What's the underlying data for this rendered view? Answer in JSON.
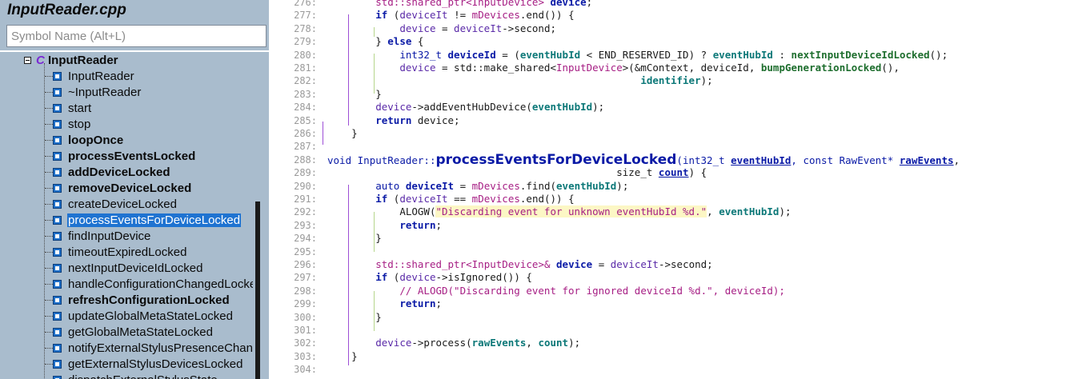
{
  "panel": {
    "title": "InputReader.cpp",
    "search_placeholder": "Symbol Name (Alt+L)",
    "root": {
      "icon": "class-icon",
      "glyph": "C",
      "label": "InputReader"
    },
    "members": [
      {
        "label": "InputReader",
        "bold": false,
        "selected": false
      },
      {
        "label": "~InputReader",
        "bold": false,
        "selected": false
      },
      {
        "label": "start",
        "bold": false,
        "selected": false
      },
      {
        "label": "stop",
        "bold": false,
        "selected": false
      },
      {
        "label": "loopOnce",
        "bold": true,
        "selected": false
      },
      {
        "label": "processEventsLocked",
        "bold": true,
        "selected": false
      },
      {
        "label": "addDeviceLocked",
        "bold": true,
        "selected": false
      },
      {
        "label": "removeDeviceLocked",
        "bold": true,
        "selected": false
      },
      {
        "label": "createDeviceLocked",
        "bold": false,
        "selected": false
      },
      {
        "label": "processEventsForDeviceLocked",
        "bold": false,
        "selected": true
      },
      {
        "label": "findInputDevice",
        "bold": false,
        "selected": false
      },
      {
        "label": "timeoutExpiredLocked",
        "bold": false,
        "selected": false
      },
      {
        "label": "nextInputDeviceIdLocked",
        "bold": false,
        "selected": false
      },
      {
        "label": "handleConfigurationChangedLocked",
        "bold": false,
        "selected": false
      },
      {
        "label": "refreshConfigurationLocked",
        "bold": true,
        "selected": false
      },
      {
        "label": "updateGlobalMetaStateLocked",
        "bold": false,
        "selected": false
      },
      {
        "label": "getGlobalMetaStateLocked",
        "bold": false,
        "selected": false
      },
      {
        "label": "notifyExternalStylusPresenceChanged",
        "bold": false,
        "selected": false
      },
      {
        "label": "getExternalStylusDevicesLocked",
        "bold": false,
        "selected": false
      },
      {
        "label": "dispatchExternalStylusState",
        "bold": false,
        "selected": false
      }
    ]
  },
  "editor": {
    "lines": [
      {
        "n": "276:",
        "indent": "        ",
        "tokens": [
          [
            "std::shared_ptr<",
            "tp"
          ],
          [
            "InputDevice",
            "tp"
          ],
          [
            "> ",
            "tp"
          ],
          [
            "device",
            "kw"
          ],
          [
            ";",
            ""
          ]
        ]
      },
      {
        "n": "277:",
        "indent": "        ",
        "tokens": [
          [
            "if",
            "kw"
          ],
          [
            " (",
            ""
          ],
          [
            "deviceIt",
            "fld"
          ],
          [
            " != ",
            ""
          ],
          [
            "mDevices",
            "vm"
          ],
          [
            ".end()) {",
            ""
          ]
        ]
      },
      {
        "n": "278:",
        "indent": "            ",
        "tokens": [
          [
            "device",
            "fld"
          ],
          [
            " = ",
            ""
          ],
          [
            "deviceIt",
            "fld"
          ],
          [
            "->second;",
            ""
          ]
        ]
      },
      {
        "n": "279:",
        "indent": "        ",
        "tokens": [
          [
            "} ",
            ""
          ],
          [
            "else",
            "kw"
          ],
          [
            " {",
            ""
          ]
        ]
      },
      {
        "n": "280:",
        "indent": "            ",
        "tokens": [
          [
            "int32_t ",
            "kt"
          ],
          [
            "deviceId",
            "kw"
          ],
          [
            " = (",
            ""
          ],
          [
            "eventHubId",
            "param"
          ],
          [
            " < END_RESERVED_ID) ? ",
            ""
          ],
          [
            "eventHubId",
            "param"
          ],
          [
            " : ",
            ""
          ],
          [
            "nextInputDeviceIdLocked",
            "fn"
          ],
          [
            "();",
            ""
          ]
        ]
      },
      {
        "n": "281:",
        "indent": "            ",
        "tokens": [
          [
            "device",
            "fld"
          ],
          [
            " = std::make_shared<",
            ""
          ],
          [
            "InputDevice",
            "tp"
          ],
          [
            ">(&mContext, deviceId, ",
            ""
          ],
          [
            "bumpGenerationLocked",
            "fn"
          ],
          [
            "(),",
            ""
          ]
        ]
      },
      {
        "n": "282:",
        "indent": "                                                    ",
        "tokens": [
          [
            "identifier",
            "param"
          ],
          [
            ");",
            ""
          ]
        ]
      },
      {
        "n": "283:",
        "indent": "        ",
        "tokens": [
          [
            "}",
            ""
          ]
        ]
      },
      {
        "n": "284:",
        "indent": "        ",
        "tokens": [
          [
            "device",
            "fld"
          ],
          [
            "->addEventHubDevice(",
            ""
          ],
          [
            "eventHubId",
            "param"
          ],
          [
            ");",
            ""
          ]
        ]
      },
      {
        "n": "285:",
        "indent": "        ",
        "tokens": [
          [
            "return",
            "kw"
          ],
          [
            " device;",
            ""
          ]
        ]
      },
      {
        "n": "286:",
        "indent": "    ",
        "tokens": [
          [
            "}",
            ""
          ]
        ]
      },
      {
        "n": "287:",
        "indent": "",
        "tokens": []
      },
      {
        "n": "288:",
        "indent": "",
        "tokens": [
          [
            "void ",
            "kt"
          ],
          [
            "InputReader::",
            "kt"
          ],
          [
            "processEventsForDeviceLocked",
            "big"
          ],
          [
            "(int32_t ",
            "kt"
          ],
          [
            "eventHubId",
            "paramu"
          ],
          [
            ", const RawEvent* ",
            "kt"
          ],
          [
            "rawEvents",
            "paramu"
          ],
          [
            ",",
            ""
          ]
        ]
      },
      {
        "n": "289:",
        "indent": "                                                ",
        "tokens": [
          [
            "size_t ",
            ""
          ],
          [
            "count",
            "paramu"
          ],
          [
            ") {",
            ""
          ]
        ]
      },
      {
        "n": "290:",
        "indent": "        ",
        "tokens": [
          [
            "auto ",
            "kt"
          ],
          [
            "deviceIt",
            "kw"
          ],
          [
            " = ",
            ""
          ],
          [
            "mDevices",
            "vm"
          ],
          [
            ".find(",
            ""
          ],
          [
            "eventHubId",
            "param"
          ],
          [
            ");",
            ""
          ]
        ]
      },
      {
        "n": "291:",
        "indent": "        ",
        "tokens": [
          [
            "if",
            "kw"
          ],
          [
            " (",
            ""
          ],
          [
            "deviceIt",
            "fld"
          ],
          [
            " == ",
            ""
          ],
          [
            "mDevices",
            "vm"
          ],
          [
            ".end()) {",
            ""
          ]
        ]
      },
      {
        "n": "292:",
        "indent": "            ",
        "tokens": [
          [
            "ALOGW(",
            ""
          ],
          [
            "\"Discarding event for unknown eventHubId %d.\"",
            "str"
          ],
          [
            ", ",
            ""
          ],
          [
            "eventHubId",
            "param"
          ],
          [
            ");",
            ""
          ]
        ]
      },
      {
        "n": "293:",
        "indent": "            ",
        "tokens": [
          [
            "return",
            "kw"
          ],
          [
            ";",
            ""
          ]
        ]
      },
      {
        "n": "294:",
        "indent": "        ",
        "tokens": [
          [
            "}",
            ""
          ]
        ]
      },
      {
        "n": "295:",
        "indent": "",
        "tokens": []
      },
      {
        "n": "296:",
        "indent": "        ",
        "tokens": [
          [
            "std::shared_ptr<",
            "tp"
          ],
          [
            "InputDevice",
            "tp"
          ],
          [
            ">& ",
            "tp"
          ],
          [
            "device",
            "kw"
          ],
          [
            " = ",
            ""
          ],
          [
            "deviceIt",
            "fld"
          ],
          [
            "->second;",
            ""
          ]
        ]
      },
      {
        "n": "297:",
        "indent": "        ",
        "tokens": [
          [
            "if",
            "kw"
          ],
          [
            " (",
            ""
          ],
          [
            "device",
            "fld"
          ],
          [
            "->isIgnored()) {",
            ""
          ]
        ]
      },
      {
        "n": "298:",
        "indent": "            ",
        "tokens": [
          [
            "// ALOGD(\"Discarding event for ignored deviceId %d.\", deviceId);",
            "cmt"
          ]
        ]
      },
      {
        "n": "299:",
        "indent": "            ",
        "tokens": [
          [
            "return",
            "kw"
          ],
          [
            ";",
            ""
          ]
        ]
      },
      {
        "n": "300:",
        "indent": "        ",
        "tokens": [
          [
            "}",
            ""
          ]
        ]
      },
      {
        "n": "301:",
        "indent": "",
        "tokens": []
      },
      {
        "n": "302:",
        "indent": "        ",
        "tokens": [
          [
            "device",
            "fld"
          ],
          [
            "->process(",
            ""
          ],
          [
            "rawEvents",
            "param"
          ],
          [
            ", ",
            ""
          ],
          [
            "count",
            "param"
          ],
          [
            ");",
            ""
          ]
        ]
      },
      {
        "n": "303:",
        "indent": "    ",
        "tokens": [
          [
            "}",
            ""
          ]
        ]
      },
      {
        "n": "304:",
        "indent": "",
        "tokens": []
      }
    ]
  }
}
